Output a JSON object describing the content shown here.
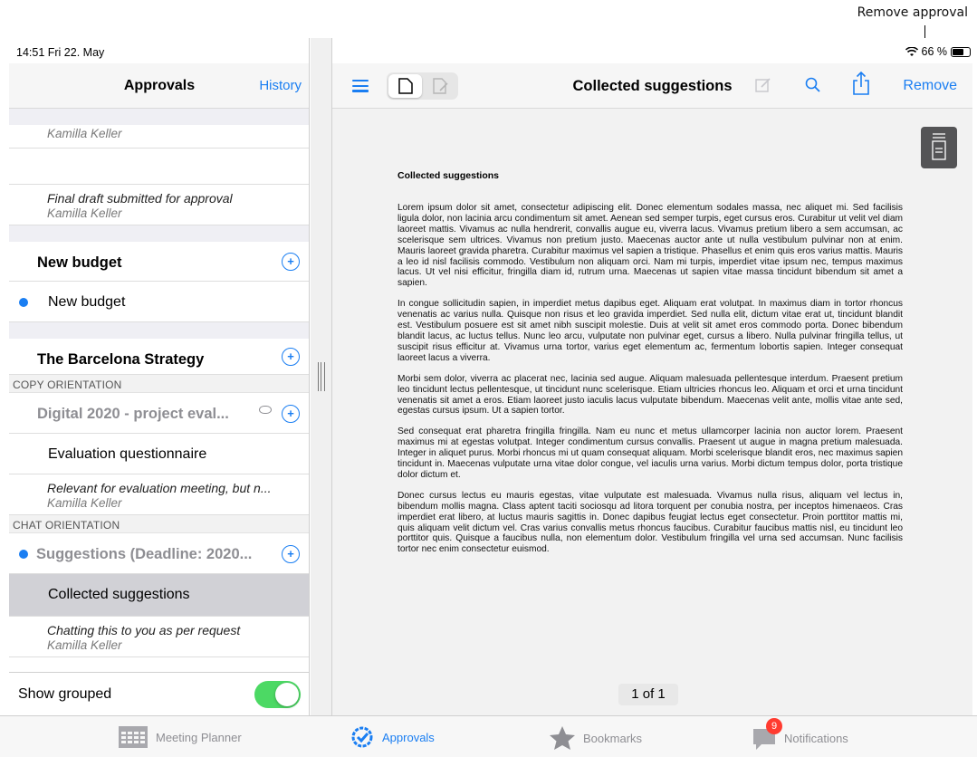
{
  "annotation": {
    "label": "Remove approval"
  },
  "status_bar": {
    "time": "14:51  Fri 22. May",
    "battery": "66 %"
  },
  "sidebar": {
    "title": "Approvals",
    "history_label": "History",
    "rows": {
      "r1_author": "Kamilla Keller",
      "r2_title": "Final draft submitted for approval",
      "r2_author": "Kamilla Keller",
      "g1_title": "New budget",
      "d1_title": "New budget",
      "g2_title": "The Barcelona Strategy",
      "cap1": "COPY ORIENTATION",
      "g3_title": "Digital 2020 - project eval...",
      "d2_title": "Evaluation questionnaire",
      "r3_title": "Relevant for evaluation meeting, but n...",
      "r3_author": "Kamilla Keller",
      "cap2": "CHAT ORIENTATION",
      "g4_title": "Suggestions (Deadline: 2020...",
      "d3_title": "Collected suggestions",
      "r4_title": "Chatting this to you as per request",
      "r4_author": "Kamilla Keller"
    },
    "show_grouped_label": "Show grouped",
    "show_grouped": true
  },
  "main": {
    "title": "Collected suggestions",
    "remove_label": "Remove",
    "page_indicator": "1 of 1",
    "document": {
      "heading": "Collected suggestions",
      "paragraphs": [
        "Lorem ipsum dolor sit amet, consectetur adipiscing elit. Donec elementum sodales massa, nec aliquet mi. Sed facilisis ligula dolor, non lacinia arcu condimentum sit amet. Aenean sed semper turpis, eget cursus eros. Curabitur ut velit vel diam laoreet mattis. Vivamus ac nulla hendrerit, convallis augue eu, viverra lacus. Vivamus pretium libero a sem accumsan, ac scelerisque sem ultrices. Vivamus non pretium justo. Maecenas auctor ante ut nulla vestibulum pulvinar non at enim. Mauris laoreet gravida pharetra. Curabitur maximus vel sapien a tristique. Phasellus et enim quis eros varius mattis. Mauris a leo id nisl facilisis commodo. Vestibulum non aliquam orci. Nam mi turpis, imperdiet vitae ipsum nec, tempus maximus lacus. Ut vel nisi efficitur, fringilla diam id, rutrum urna. Maecenas ut sapien vitae massa tincidunt bibendum sit amet a sapien.",
        "In congue sollicitudin sapien, in imperdiet metus dapibus eget. Aliquam erat volutpat. In maximus diam in tortor rhoncus venenatis ac varius nulla. Quisque non risus et leo gravida imperdiet. Sed nulla elit, dictum vitae erat ut, tincidunt blandit est. Vestibulum posuere est sit amet nibh suscipit molestie. Duis at velit sit amet eros commodo porta. Donec bibendum blandit lacus, ac luctus tellus. Nunc leo arcu, vulputate non pulvinar eget, cursus a libero. Nulla pulvinar fringilla tellus, ut suscipit risus efficitur at. Vivamus urna tortor, varius eget elementum ac, fermentum lobortis sapien. Integer consequat laoreet lacus a viverra.",
        "Morbi sem dolor, viverra ac placerat nec, lacinia sed augue. Aliquam malesuada pellentesque interdum. Praesent pretium leo tincidunt lectus pellentesque, ut tincidunt nunc scelerisque. Etiam ultricies rhoncus leo. Aliquam et orci et urna tincidunt venenatis sit amet a eros. Etiam laoreet justo iaculis lacus vulputate bibendum. Maecenas velit ante, mollis vitae ante sed, egestas cursus ipsum. Ut a sapien tortor.",
        "Sed consequat erat pharetra fringilla fringilla. Nam eu nunc et metus ullamcorper lacinia non auctor lorem. Praesent maximus mi at egestas volutpat. Integer condimentum cursus convallis. Praesent ut augue in magna pretium malesuada. Integer in aliquet purus. Morbi rhoncus mi ut quam consequat aliquam. Morbi scelerisque blandit eros, nec maximus sapien tincidunt in. Maecenas vulputate urna vitae dolor congue, vel iaculis urna varius. Morbi dictum tempus dolor, porta tristique dolor dictum et.",
        "Donec cursus lectus eu mauris egestas, vitae vulputate est malesuada. Vivamus nulla risus, aliquam vel lectus in, bibendum mollis magna. Class aptent taciti sociosqu ad litora torquent per conubia nostra, per inceptos himenaeos. Cras imperdiet erat libero, at luctus mauris sagittis in. Donec dapibus feugiat lectus eget consectetur. Proin porttitor mattis mi, quis aliquam velit dictum vel. Cras varius convallis metus rhoncus faucibus. Curabitur faucibus mattis nisl, eu tincidunt leo porttitor quis. Quisque a faucibus nulla, non elementum dolor. Vestibulum fringilla vel urna sed accumsan. Nunc facilisis tortor nec enim consectetur euismod."
      ]
    }
  },
  "tabbar": {
    "meeting_planner": "Meeting Planner",
    "approvals": "Approvals",
    "bookmarks": "Bookmarks",
    "notifications": "Notifications",
    "notifications_badge": "9"
  },
  "colors": {
    "accent": "#1a7ef2",
    "toggle_on": "#4cd964",
    "badge": "#ff3b30"
  }
}
